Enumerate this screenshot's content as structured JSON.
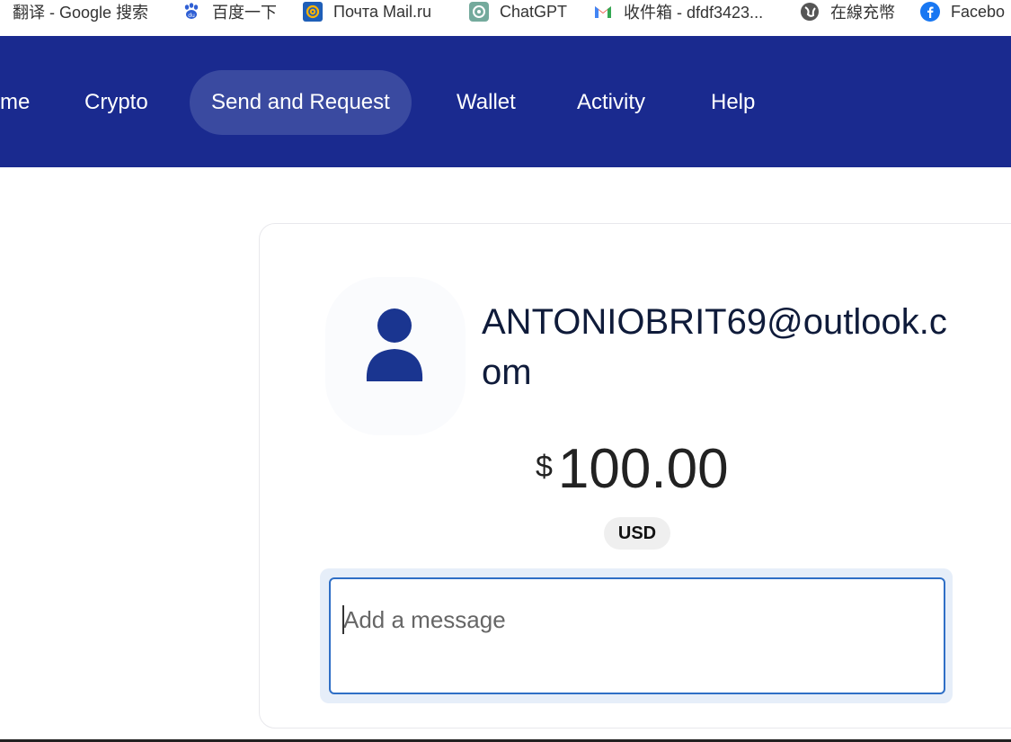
{
  "bookmarks": [
    {
      "label": "翻译 - Google 搜索",
      "icon": "none"
    },
    {
      "label": "百度一下",
      "icon": "baidu-icon"
    },
    {
      "label": "Почта Mail.ru",
      "icon": "mailru-icon"
    },
    {
      "label": "ChatGPT",
      "icon": "chatgpt-icon"
    },
    {
      "label": "收件箱 - dfdf3423...",
      "icon": "gmail-icon"
    },
    {
      "label": "在線充幣",
      "icon": "globe-icon"
    },
    {
      "label": "Facebo",
      "icon": "facebook-icon"
    }
  ],
  "nav": {
    "items": [
      {
        "label": "me"
      },
      {
        "label": "Crypto"
      },
      {
        "label": "Send and Request",
        "active": true
      },
      {
        "label": "Wallet"
      },
      {
        "label": "Activity"
      },
      {
        "label": "Help"
      }
    ],
    "bg_color": "#1a2a8f"
  },
  "payment": {
    "recipient": "ANTONIOBRIT69@outlook.com",
    "currency_symbol": "$",
    "amount": "100.00",
    "currency": "USD"
  },
  "message": {
    "placeholder": "Add a message",
    "value": ""
  },
  "colors": {
    "avatar": "#1a3590",
    "input_border": "#2f6fc6"
  }
}
